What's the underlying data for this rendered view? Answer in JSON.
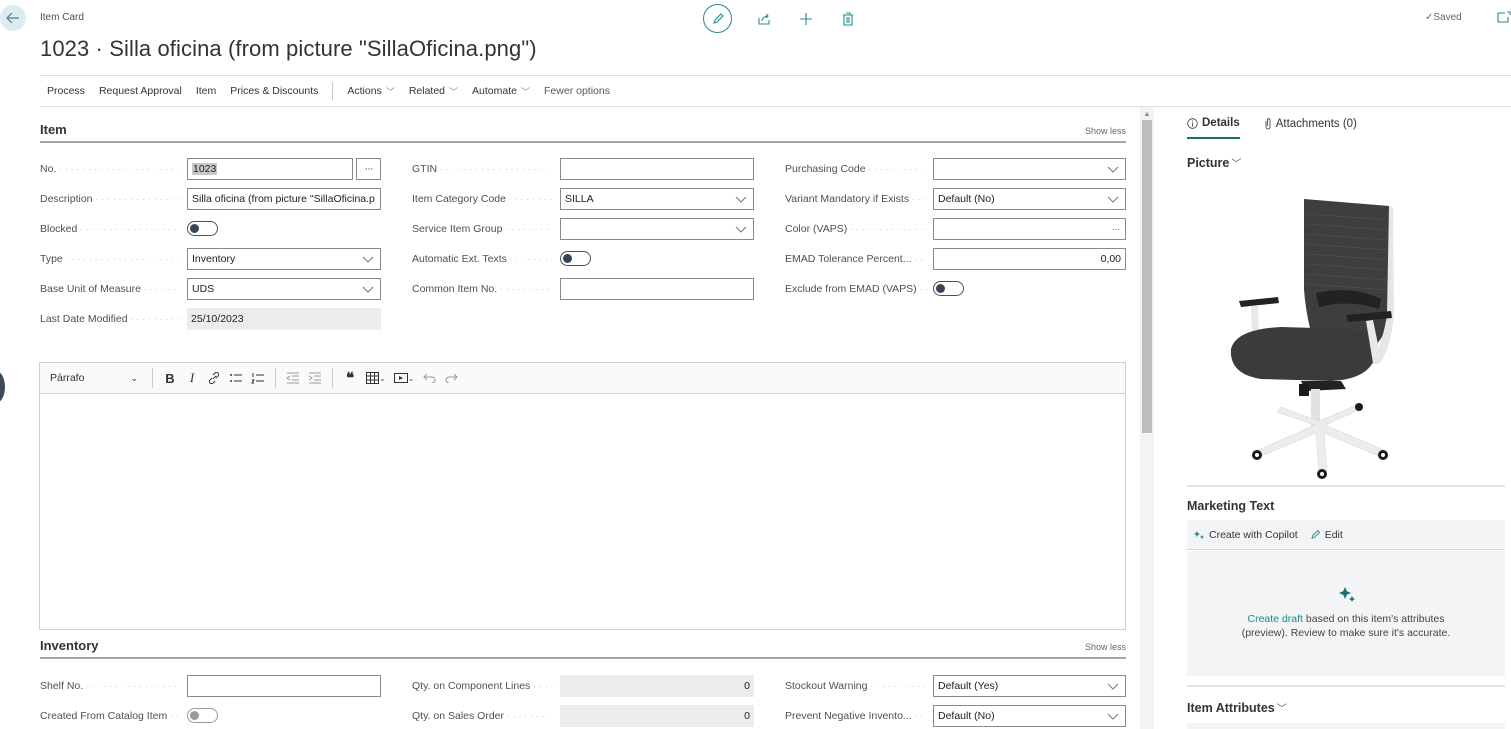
{
  "header": {
    "breadcrumb": "Item Card",
    "title": "1023 · Silla oficina (from picture \"SillaOficina.png\")",
    "status": "Saved",
    "accent_color": "#2b8a8f"
  },
  "action_bar": {
    "items": [
      "Process",
      "Request Approval",
      "Item",
      "Prices & Discounts"
    ],
    "menus": [
      "Actions",
      "Related",
      "Automate"
    ],
    "fewer_options": "Fewer options"
  },
  "item_section": {
    "title": "Item",
    "show_less": "Show less",
    "col1": {
      "no_label": "No.",
      "no_value": "1023",
      "description_label": "Description",
      "description_value": "Silla oficina (from picture \"SillaOficina.p",
      "blocked_label": "Blocked",
      "blocked_value": false,
      "type_label": "Type",
      "type_value": "Inventory",
      "base_uom_label": "Base Unit of Measure",
      "base_uom_value": "UDS",
      "last_modified_label": "Last Date Modified",
      "last_modified_value": "25/10/2023"
    },
    "col2": {
      "gtin_label": "GTIN",
      "gtin_value": "",
      "category_label": "Item Category Code",
      "category_value": "SILLA",
      "service_group_label": "Service Item Group",
      "service_group_value": "",
      "auto_ext_label": "Automatic Ext. Texts",
      "auto_ext_value": false,
      "common_no_label": "Common Item No.",
      "common_no_value": ""
    },
    "col3": {
      "purchasing_label": "Purchasing Code",
      "purchasing_value": "",
      "variant_label": "Variant Mandatory if Exists",
      "variant_value": "Default (No)",
      "color_label": "Color (VAPS)",
      "color_value": "",
      "emad_tol_label": "EMAD Tolerance Percent...",
      "emad_tol_value": "0,00",
      "exclude_emad_label": "Exclude from EMAD (VAPS)",
      "exclude_emad_value": false
    }
  },
  "editor": {
    "style": "Párrafo",
    "buttons": [
      "bold",
      "italic",
      "link",
      "bullet-list",
      "numbered-list",
      "outdent",
      "indent",
      "quote",
      "table",
      "media",
      "undo",
      "redo"
    ],
    "bold_glyph": "B",
    "italic_glyph": "I"
  },
  "inventory_section": {
    "title": "Inventory",
    "show_less": "Show less",
    "shelf_label": "Shelf No.",
    "shelf_value": "",
    "catalog_label": "Created From Catalog Item",
    "catalog_value": false,
    "comp_lines_label": "Qty. on Component Lines",
    "comp_lines_value": "0",
    "sales_order_label": "Qty. on Sales Order",
    "sales_order_value": "0",
    "stockout_label": "Stockout Warning",
    "stockout_value": "Default (Yes)",
    "prevent_neg_label": "Prevent Negative Invento...",
    "prevent_neg_value": "Default (No)"
  },
  "factbox": {
    "tabs": [
      "Details",
      "Attachments (0)"
    ],
    "picture_heading": "Picture",
    "marketing_heading": "Marketing Text",
    "create_copilot": "Create with Copilot",
    "edit": "Edit",
    "create_draft_link": "Create draft",
    "draft_text_1": " based on this item's attributes",
    "draft_text_2": "(preview). Review to make sure it's accurate.",
    "attributes_heading": "Item Attributes"
  }
}
